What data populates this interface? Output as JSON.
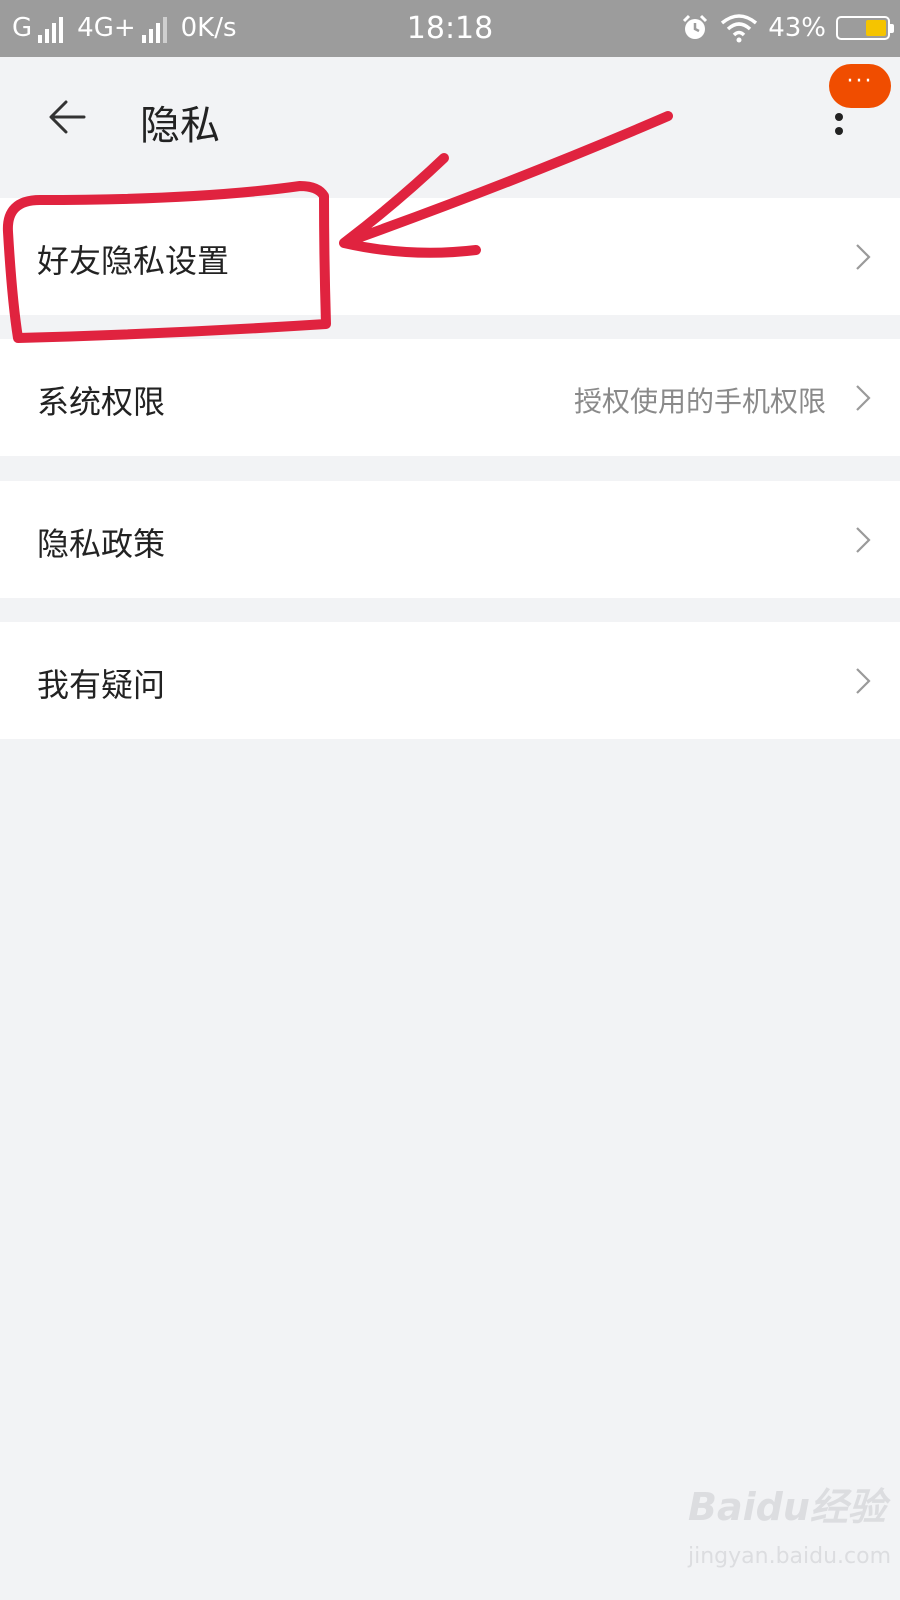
{
  "status_bar": {
    "carrier1": "G",
    "carrier2": "4G+",
    "speed": "0K/s",
    "time": "18:18",
    "battery": "43%",
    "battery_level": 0.43,
    "icons": [
      "signal-icon",
      "alarm-icon",
      "wifi-icon",
      "battery-icon"
    ]
  },
  "header": {
    "title": "隐私",
    "back_icon": "back-arrow-icon",
    "more_icon": "more-vertical-icon",
    "badge_text": "···"
  },
  "list": {
    "items": [
      {
        "label": "好友隐私设置",
        "value": ""
      },
      {
        "label": "系统权限",
        "value": "授权使用的手机权限"
      },
      {
        "label": "隐私政策",
        "value": ""
      },
      {
        "label": "我有疑问",
        "value": ""
      }
    ]
  },
  "annotation": {
    "color": "#e0233f"
  },
  "watermark": {
    "logo_text": "Baidu经验",
    "url": "jingyan.baidu.com"
  },
  "colors": {
    "accent": "#f04d00",
    "background": "#f2f3f5",
    "statusbar": "#9c9c9c",
    "battery_fill": "#f5c400"
  }
}
